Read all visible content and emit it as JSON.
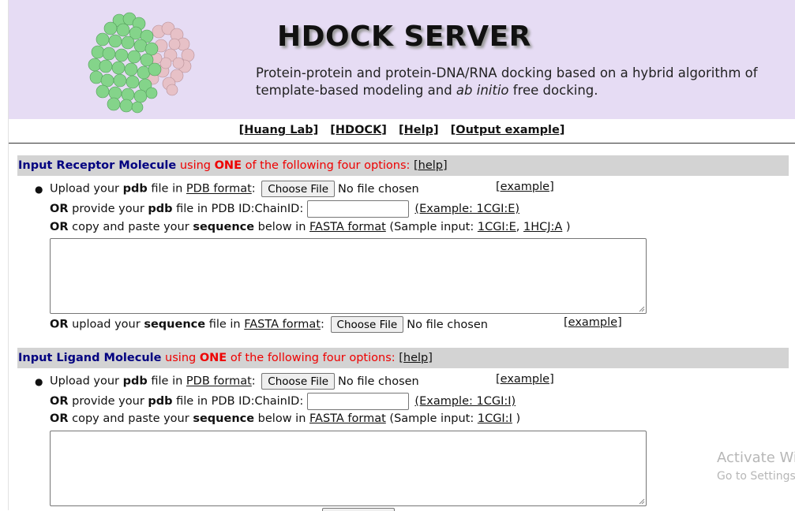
{
  "header": {
    "title": "HDOCK SERVER",
    "subtitle_part1": "Protein-protein and protein-DNA/RNA docking based on a hybrid algorithm of template-based modeling and ",
    "subtitle_italic": "ab initio",
    "subtitle_part2": " free docking."
  },
  "nav": {
    "items": [
      "[Huang Lab]",
      "[HDOCK]",
      "[Help]",
      "[Output example]"
    ]
  },
  "receptor": {
    "head_title": "Input Receptor Molecule",
    "head_using": " using ",
    "head_one": "ONE",
    "head_rest": " of the following four options: ",
    "head_help": "[help]",
    "upload_pre": "Upload your ",
    "upload_bold": "pdb",
    "upload_mid": " file in ",
    "upload_link": "PDB format",
    "upload_colon": ":",
    "choose_file": "Choose File",
    "no_file": "No file chosen",
    "example": "[example]",
    "pdbid_or": "OR",
    "pdbid_pre": " provide your ",
    "pdbid_bold": "pdb",
    "pdbid_rest": " file in PDB ID:ChainID:",
    "pdbid_value": "",
    "pdbid_example": "(Example: 1CGI:E)",
    "seq_or": "OR",
    "seq_pre": " copy and paste your ",
    "seq_bold": "sequence",
    "seq_mid": " below in ",
    "seq_link": "FASTA format",
    "seq_sample": " (Sample input: ",
    "seq_s1": "1CGI:E",
    "seq_comma": ", ",
    "seq_s2": "1HCJ:A",
    "seq_close": " )",
    "seq_value": "",
    "fasta_or": "OR",
    "fasta_pre": " upload your ",
    "fasta_bold": "sequence",
    "fasta_mid": " file in ",
    "fasta_link": "FASTA format",
    "fasta_colon": ":",
    "fasta_choose": "Choose File",
    "fasta_nofile": "No file chosen",
    "fasta_example": "[example]"
  },
  "ligand": {
    "head_title": "Input Ligand Molecule",
    "head_using": " using ",
    "head_one": "ONE",
    "head_rest": " of the following four options: ",
    "head_help": "[help]",
    "upload_pre": "Upload your ",
    "upload_bold": "pdb",
    "upload_mid": " file in ",
    "upload_link": "PDB format",
    "upload_colon": ":",
    "choose_file": "Choose File",
    "no_file": "No file chosen",
    "example": "[example]",
    "pdbid_or": "OR",
    "pdbid_pre": " provide your ",
    "pdbid_bold": "pdb",
    "pdbid_rest": " file in PDB ID:ChainID:",
    "pdbid_value": "",
    "pdbid_example": "(Example: 1CGI:I)",
    "seq_or": "OR",
    "seq_pre": " copy and paste your ",
    "seq_bold": "sequence",
    "seq_mid": " below in ",
    "seq_link": "FASTA format",
    "seq_sample": " (Sample input: ",
    "seq_s1": "1CGI:I",
    "seq_close": " )",
    "seq_value": ""
  },
  "watermark": {
    "line1": "Activate Wi",
    "line2": "Go to Settings"
  },
  "colors": {
    "banner": "#e6dcf4",
    "section_bar": "#d3d3d3",
    "heading_blue": "#000080",
    "emphasis_red": "#ee0000",
    "molecule_green": "#7ccf7e",
    "molecule_pink": "#e7c1c7"
  }
}
